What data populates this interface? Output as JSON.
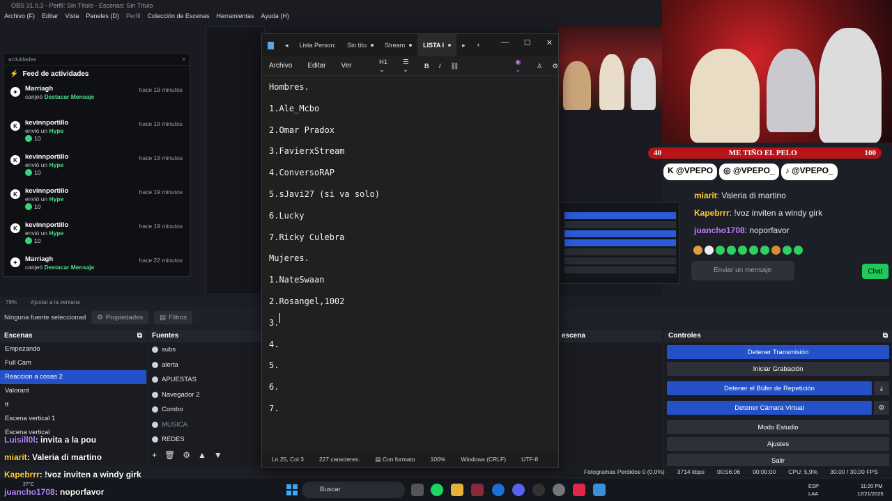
{
  "obs": {
    "title": "OBS 31.0.3 - Perfil: Sin Título - Escenas: Sin Título",
    "menu": [
      "Archivo (F)",
      "Editar",
      "Vista",
      "Paneles (D)",
      "Perfil",
      "Colección de Escenas",
      "Herramientas",
      "Ayuda (H)"
    ],
    "zoom_label": "79%",
    "zoom_mode": "Ajustar a la ventana",
    "no_source": "Ninguna fuente seleccionad",
    "properties_btn": "Propiedades",
    "filters_btn": "Filtros",
    "scenes_title": "Escenas",
    "scenes": [
      "Empezando",
      "Full Cam",
      "Reaccion a cosas 2",
      "Valorant",
      "tt",
      "Escena vertical 1",
      "Escena vertical"
    ],
    "selected_scene_index": 2,
    "sources_title": "Fuentes",
    "sources": [
      "subs",
      "alerta",
      "APUESTAS",
      "Navegador 2",
      "Combo",
      "MUSICA",
      "REDES"
    ],
    "mixer_title": "escena",
    "controls_title": "Controles",
    "controls": {
      "stop_stream": "Detener Transmisión",
      "start_record": "Iniciar Grabación",
      "stop_replay": "Detener el Búfer de Repetición",
      "stop_vcam": "Detener Cámara Virtual",
      "studio_mode": "Modo Estudio",
      "settings": "Ajustes",
      "exit": "Salir"
    },
    "status": {
      "dropped": "Fotogramas Perdidos 0 (0.0%)",
      "bitrate": "3714 kbps",
      "stream_time": "00:56:06",
      "rec_time": "00:00:00",
      "cpu": "CPU: 5,9%",
      "fps": "30.00 / 30.00 FPS"
    }
  },
  "activity": {
    "panel_label": "actividades",
    "title": "Feed de actividades",
    "items": [
      {
        "user": "Marriagh",
        "time": "hace 19 minutos",
        "verb": "canjeó",
        "item": "Destacar Mensaje",
        "amount": ""
      },
      {
        "user": "kevinnportillo",
        "time": "hace 19 minutos",
        "verb": "envió un",
        "item": "Hype",
        "amount": "10"
      },
      {
        "user": "kevinnportillo",
        "time": "hace 19 minutos",
        "verb": "envió un",
        "item": "Hype",
        "amount": "10"
      },
      {
        "user": "kevinnportillo",
        "time": "hace 19 minutos",
        "verb": "envió un",
        "item": "Hype",
        "amount": "10"
      },
      {
        "user": "kevinnportillo",
        "time": "hace 19 minutos",
        "verb": "envió un",
        "item": "Hype",
        "amount": "10"
      },
      {
        "user": "Marriagh",
        "time": "hace 22 minutos",
        "verb": "canjeó",
        "item": "Destacar Mensaje",
        "amount": ""
      }
    ]
  },
  "stream": {
    "banner_left": "40",
    "banner_text": "ME TIÑO EL PELO",
    "banner_right": "100",
    "socials": [
      "@VPEPO",
      "@VPEPO_",
      "@VPEPO_"
    ],
    "chat": [
      {
        "user": "miarit",
        "text": "Valeria di martino"
      },
      {
        "user": "Kapebrrr",
        "text": "!voz inviten a windy girk"
      },
      {
        "user": "juancho1708",
        "text": "noporfavor"
      }
    ],
    "chat_placeholder": "Enviar un mensaje",
    "chat_button": "Chat"
  },
  "overlay_chat": [
    {
      "user": "Luisill0l",
      "text": ": invita a la pou"
    },
    {
      "user": "miarit",
      "text": ": Valeria di martino"
    },
    {
      "user": "Kapebrrr",
      "text": ": !voz inviten a windy girk"
    },
    {
      "user": "juancho1708",
      "text": ": noporfavor"
    }
  ],
  "notepad": {
    "tabs": [
      "Lista Person:",
      "Sin títu",
      "Stream",
      "LISTA I"
    ],
    "menu": [
      "Archivo",
      "Editar",
      "Ver"
    ],
    "heading_select": "H1",
    "lines": [
      "Hombres.",
      "1.Ale_Mcbo",
      "2.Omar Pradox",
      "3.FavierxStream",
      "4.ConversoRAP",
      "5.sJavi27 (si va solo)",
      "6.Lucky",
      "7.Ricky Culebra",
      "Mujeres.",
      "1.NateSwaan",
      "2.Rosangel,1002",
      "3.",
      "4.",
      "5.",
      "6.",
      "7."
    ],
    "status": {
      "position": "Ln 25, Col 3",
      "chars": "227 caracteres.",
      "format": "Con formato",
      "zoom": "100%",
      "eol": "Windows (CRLF)",
      "encoding": "UTF-8"
    }
  },
  "taskbar": {
    "search": "Buscar",
    "weather": "27°C",
    "lang": "ESP",
    "region": "LAA",
    "time": "11:20 PM",
    "date": "12/21/2025"
  }
}
